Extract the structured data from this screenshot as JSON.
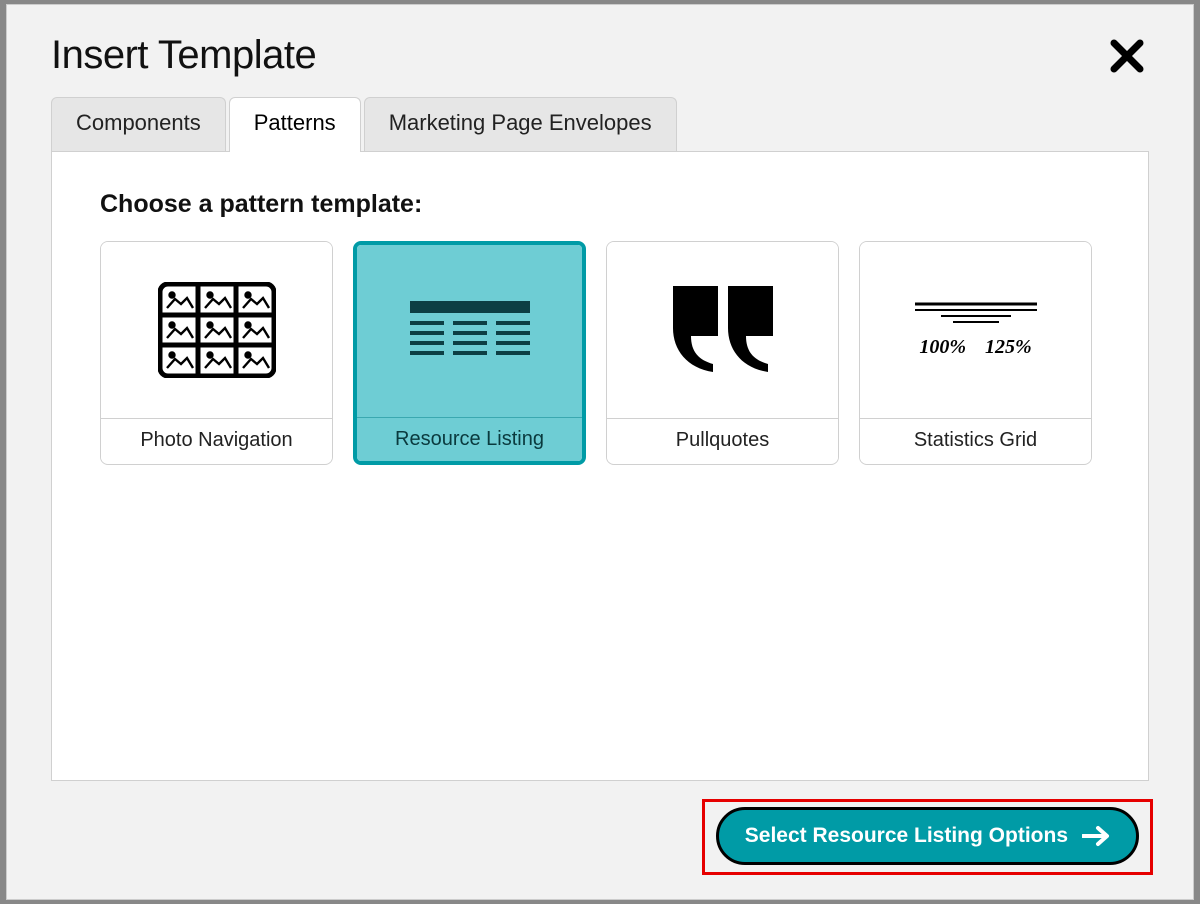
{
  "modal": {
    "title": "Insert Template",
    "tabs": [
      {
        "label": "Components",
        "active": false
      },
      {
        "label": "Patterns",
        "active": true
      },
      {
        "label": "Marketing Page Envelopes",
        "active": false
      }
    ],
    "prompt": "Choose a pattern template:",
    "patterns": [
      {
        "label": "Photo Navigation",
        "icon": "photo-grid-icon",
        "selected": false
      },
      {
        "label": "Resource Listing",
        "icon": "resource-listing-icon",
        "selected": true
      },
      {
        "label": "Pullquotes",
        "icon": "pullquotes-icon",
        "selected": false
      },
      {
        "label": "Statistics Grid",
        "icon": "statistics-grid-icon",
        "selected": false,
        "stat_a": "100%",
        "stat_b": "125%"
      }
    ],
    "action_button": "Select Resource Listing Options",
    "close_label": "Close"
  }
}
